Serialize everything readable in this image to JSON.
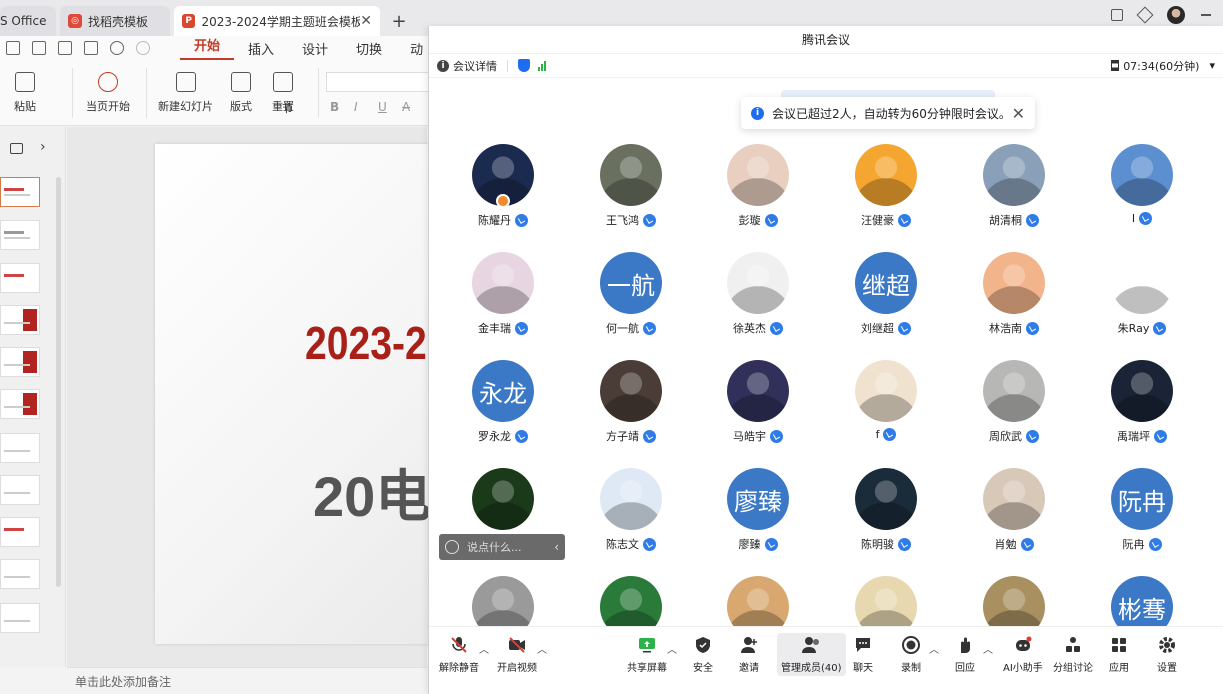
{
  "wps": {
    "tabs": [
      {
        "label": "S Office"
      },
      {
        "label": "找稻壳模板"
      },
      {
        "label": "2023-2024学期主题班会模板."
      }
    ],
    "menu": [
      "开始",
      "插入",
      "设计",
      "切换",
      "动"
    ],
    "ribbon": {
      "paste": "粘贴",
      "start_from_current": "当页开始",
      "new_slide": "新建幻灯片",
      "layout": "版式",
      "section": "节",
      "reset": "重置",
      "format_glyphs": [
        "B",
        "I",
        "U",
        "A"
      ]
    },
    "slide": {
      "line1": "2023-2",
      "line2": "20电"
    },
    "notes_placeholder": "单击此处添加备注"
  },
  "meeting": {
    "window_title": "腾讯会议",
    "info_label": "会议详情",
    "timer": "07:34(60分钟)",
    "toast": "会议已超过2人，自动转为60分钟限时会议。",
    "reaction_placeholder": "说点什么...",
    "participants": [
      {
        "name": "陈耀丹",
        "avatar": "photo",
        "color": "#1b2b50",
        "host": true
      },
      {
        "name": "王飞鸿",
        "avatar": "photo",
        "color": "#6a7060"
      },
      {
        "name": "彭璇",
        "avatar": "photo",
        "color": "#e8cfc0"
      },
      {
        "name": "汪健豪",
        "avatar": "photo",
        "color": "#f4a630"
      },
      {
        "name": "胡清桐",
        "avatar": "photo",
        "color": "#8aa0b8"
      },
      {
        "name": "I",
        "avatar": "photo",
        "color": "#5b8fd0"
      },
      {
        "name": "金丰瑞",
        "avatar": "photo",
        "color": "#e7d6e2"
      },
      {
        "name": "何一航",
        "avatar": "text",
        "text": "一航",
        "color": "#3b78c6"
      },
      {
        "name": "徐英杰",
        "avatar": "photo",
        "color": "#f0f0f0"
      },
      {
        "name": "刘继超",
        "avatar": "text",
        "text": "继超",
        "color": "#3b78c6"
      },
      {
        "name": "林浩南",
        "avatar": "photo",
        "color": "#f2b48a"
      },
      {
        "name": "朱Ray",
        "avatar": "photo",
        "color": "#ffffff"
      },
      {
        "name": "罗永龙",
        "avatar": "text",
        "text": "永龙",
        "color": "#3b78c6"
      },
      {
        "name": "方子靖",
        "avatar": "photo",
        "color": "#4a3d38"
      },
      {
        "name": "马皓宇",
        "avatar": "photo",
        "color": "#30305a"
      },
      {
        "name": "f",
        "avatar": "photo",
        "color": "#efe3cf"
      },
      {
        "name": "周欣武",
        "avatar": "photo",
        "color": "#b7b7b5"
      },
      {
        "name": "禹瑞坪",
        "avatar": "photo",
        "color": "#1a2436"
      },
      {
        "name": "",
        "avatar": "photo",
        "color": "#1b3a1a"
      },
      {
        "name": "陈志文",
        "avatar": "photo",
        "color": "#dfe9f5"
      },
      {
        "name": "廖臻",
        "avatar": "text",
        "text": "廖臻",
        "color": "#3b78c6"
      },
      {
        "name": "陈明骏",
        "avatar": "photo",
        "color": "#1a2b3a"
      },
      {
        "name": "肖勉",
        "avatar": "photo",
        "color": "#d8c8b8"
      },
      {
        "name": "阮冉",
        "avatar": "text",
        "text": "阮冉",
        "color": "#3b78c6"
      },
      {
        "name": "",
        "avatar": "photo",
        "color": "#9a9a9a"
      },
      {
        "name": "",
        "avatar": "photo",
        "color": "#2a7a3a"
      },
      {
        "name": "",
        "avatar": "photo",
        "color": "#d8a870"
      },
      {
        "name": "",
        "avatar": "photo",
        "color": "#e8d8b0"
      },
      {
        "name": "",
        "avatar": "photo",
        "color": "#a89060"
      },
      {
        "name": "",
        "avatar": "text",
        "text": "彬骞",
        "color": "#3b78c6"
      }
    ],
    "toolbar": {
      "unmute": "解除静音",
      "video": "开启视频",
      "share": "共享屏幕",
      "security": "安全",
      "invite": "邀请",
      "members": "管理成员(40)",
      "chat": "聊天",
      "record": "录制",
      "react": "回应",
      "ai": "AI小助手",
      "breakout": "分组讨论",
      "apps": "应用",
      "settings": "设置"
    },
    "colors": {
      "accent": "#1e6cf0",
      "avatar_blue": "#3b78c6",
      "wps_red": "#c33b28"
    }
  }
}
